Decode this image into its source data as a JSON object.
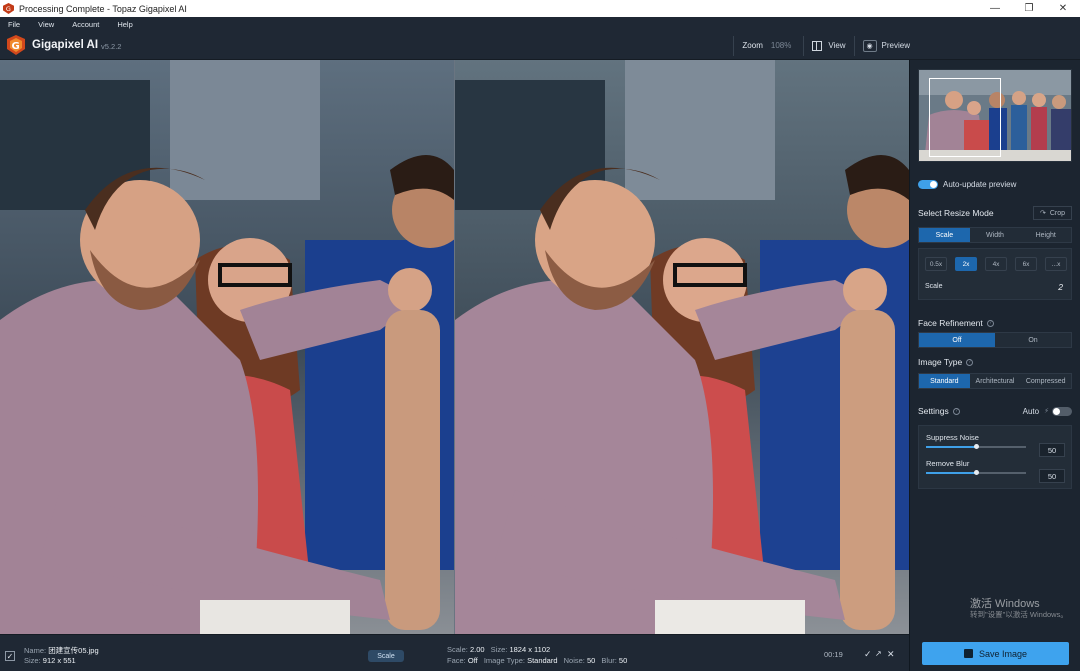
{
  "window": {
    "title": "Processing Complete - Topaz Gigapixel AI"
  },
  "menu": [
    "File",
    "View",
    "Account",
    "Help"
  ],
  "header": {
    "app_name": "Gigapixel AI",
    "version": "v5.2.2",
    "zoom_label": "Zoom",
    "zoom_value": "108%",
    "view_label": "View",
    "preview_label": "Preview"
  },
  "panel": {
    "auto_update_label": "Auto-update preview",
    "resize_mode_title": "Select Resize Mode",
    "crop_label": "Crop",
    "resize_tabs": [
      "Scale",
      "Width",
      "Height"
    ],
    "resize_active": 0,
    "scale_chips": [
      "0.5x",
      "2x",
      "4x",
      "6x",
      "...x"
    ],
    "scale_active": 1,
    "scale_label": "Scale",
    "scale_value": "2",
    "face_title": "Face Refinement",
    "face_tabs": [
      "Off",
      "On"
    ],
    "image_type_title": "Image Type",
    "image_type_tabs": [
      "Standard",
      "Architectural",
      "Compressed"
    ],
    "settings_title": "Settings",
    "auto_label": "Auto",
    "suppress_noise_label": "Suppress Noise",
    "suppress_noise_value": "50",
    "suppress_noise_level": 50,
    "remove_blur_label": "Remove Blur",
    "remove_blur_value": "50",
    "remove_blur_level": 50
  },
  "bottom": {
    "name_label": "Name:",
    "name_value": "团建宣传05.jpg",
    "size_label": "Size:",
    "size_value": "912 x 551",
    "scale_badge": "Scale",
    "scale_label": "Scale:",
    "scale_value": "2.00",
    "out_size_label": "Size:",
    "out_size_value": "1824 x 1102",
    "face_label": "Face:",
    "face_value": "Off",
    "type_label": "Image Type:",
    "type_value": "Standard",
    "noise_label": "Noise:",
    "noise_value": "50",
    "blur_label": "Blur:",
    "blur_value": "50",
    "time": "00:19",
    "save_label": "Save Image"
  },
  "watermark": {
    "line1": "激活 Windows",
    "line2": "转到\"设置\"以激活 Windows。"
  },
  "colors": {
    "accent": "#3ea3ee",
    "active_tab": "#1d67ad",
    "background": "#1c2530"
  }
}
